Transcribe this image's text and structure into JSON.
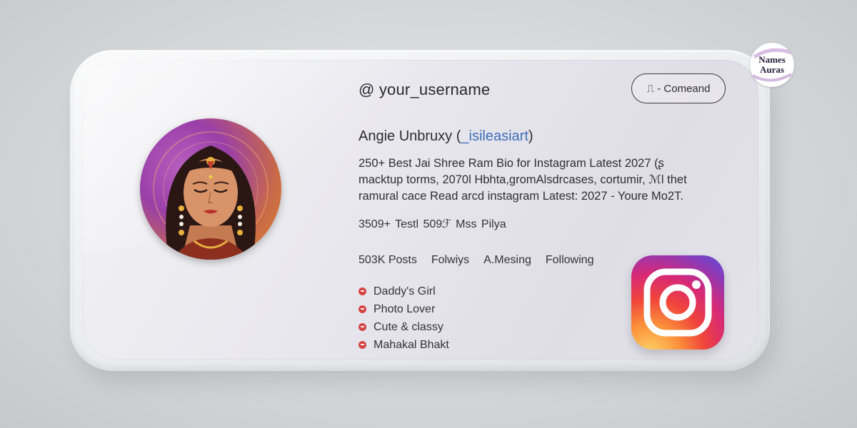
{
  "profile": {
    "username": "@ your_username",
    "command_button_label": "⎍ - Comeand",
    "display_name": "Angie Unbruxy (",
    "display_tag": "_isileasiart",
    "display_close": ")",
    "bio_lines": [
      "250+ Best Jai Shree Ram Bio for Instagram Latest 2027  (ʂ",
      "macktup torms, 2070l Hbhta,gromAlsdrcases, cortumir, ℳl thet",
      "ramural cace Read  arcd instagram Latest: 2027 - Youre Mo2T."
    ],
    "stats_line": "3509+ Testl  509ℱ Mss Pilya",
    "counts": [
      "503K Posts",
      "Folwiys",
      "A.Mesing",
      "Following"
    ],
    "bio_list": [
      "Daddy's Girl",
      "Photo Lover",
      "Cute & classy",
      "Mahakal Bhakt"
    ]
  },
  "badge": {
    "line1": "Names",
    "line2": "Auras"
  },
  "icons": {
    "command": "music-note-icon",
    "bullet": "red-dot-icon",
    "instagram": "instagram-logo-icon"
  },
  "colors": {
    "tag_blue": "#3d6fb8",
    "bullet_red": "#d64545",
    "text_dark": "#2a2a2e"
  }
}
